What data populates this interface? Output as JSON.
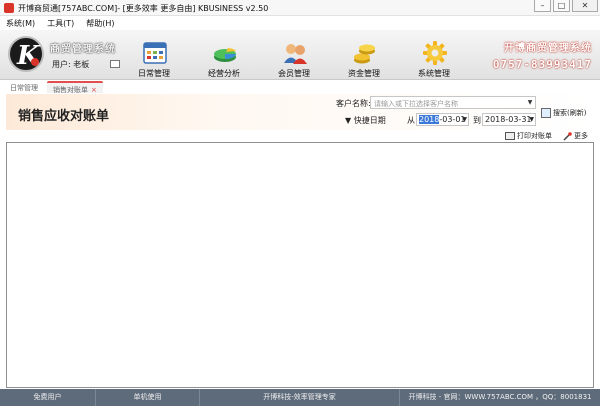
{
  "window": {
    "title": "开博商贸通[757ABC.COM]- [更多效率 更多自由]  KBUSINESS v2.50",
    "minimize": "–",
    "maximize": "□",
    "close": "✕"
  },
  "menu": [
    "系统(M)",
    "工具(T)",
    "帮助(H)"
  ],
  "brand": {
    "logo_letter": "K",
    "system_name": "商贸管理系统",
    "user_label": "用户: 老板",
    "hotline_title": "开博商贸管理系统",
    "hotline_phone": "0757-83993417"
  },
  "toolbar": [
    {
      "label": "日常管理",
      "icon": "calendar-icon"
    },
    {
      "label": "经营分析",
      "icon": "pie-chart-icon"
    },
    {
      "label": "会员管理",
      "icon": "members-icon"
    },
    {
      "label": "资金管理",
      "icon": "coins-icon"
    },
    {
      "label": "系统管理",
      "icon": "gear-icon"
    }
  ],
  "tabs": {
    "home": "日常管理",
    "active": "销售对账单",
    "close": "×"
  },
  "page": {
    "title": "销售应收对账单",
    "customer_label": "客户名称:",
    "customer_placeholder": "请输入或下拉选择客户名称",
    "quick_date": "快捷日期",
    "from_label": "从",
    "from_year": "2018",
    "from_rest": "-03-01",
    "to_label": "到",
    "to_date": "2018-03-31",
    "search_label": "搜索(刷新)",
    "print_label": "打印对账单",
    "more_label": "更多"
  },
  "status": {
    "user_type": "免费用户",
    "mode": "单机使用",
    "slogan": "开博科技-效率管理专家",
    "contact": "开博科技 - 官网：WWW.757ABC.COM ，QQ：8001831"
  },
  "colors": {
    "accent_red": "#d8342a",
    "status_bar": "#5e6b7b"
  }
}
